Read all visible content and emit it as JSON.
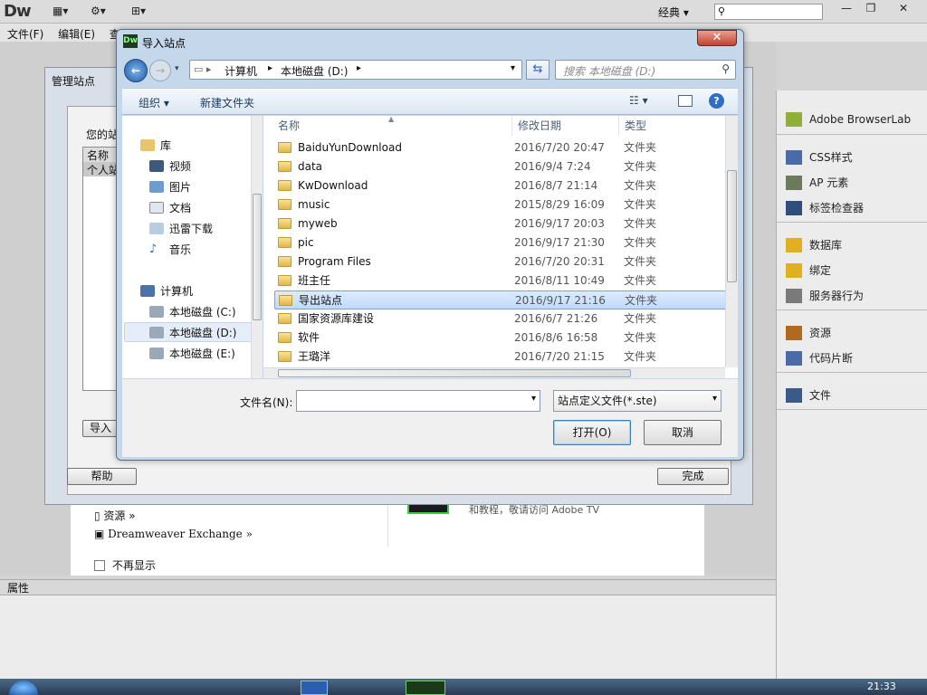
{
  "app": {
    "logo": "Dw",
    "workspace": "经典 ▾",
    "toolbar_icons": [
      "layout-icon",
      "gear-icon",
      "site-icon"
    ],
    "window_buttons": [
      "—",
      "❐",
      "✕"
    ]
  },
  "menu": [
    "文件(F)",
    "编辑(E)",
    "查"
  ],
  "right_panel": {
    "groups": [
      {
        "items": [
          {
            "icon": "browserlab-icon",
            "label": "Adobe BrowserLab"
          }
        ]
      },
      {
        "items": [
          {
            "icon": "css-icon",
            "label": "CSS样式"
          },
          {
            "icon": "ap-icon",
            "label": "AP 元素"
          },
          {
            "icon": "tag-inspector-icon",
            "label": "标签检查器"
          }
        ]
      },
      {
        "items": [
          {
            "icon": "database-icon",
            "label": "数据库"
          },
          {
            "icon": "binding-icon",
            "label": "绑定"
          },
          {
            "icon": "server-behavior-icon",
            "label": "服务器行为"
          }
        ]
      },
      {
        "items": [
          {
            "icon": "assets-icon",
            "label": "资源"
          },
          {
            "icon": "snippets-icon",
            "label": "代码片断"
          }
        ]
      },
      {
        "items": [
          {
            "icon": "files-icon",
            "label": "文件"
          }
        ]
      }
    ]
  },
  "properties": {
    "title": "属性"
  },
  "welcome": {
    "assets_link": "资源 »",
    "exchange_link": "Dreamweaver Exchange »",
    "dont_show": "不再显示",
    "tv_text": "和教程，敬请访问 Adobe TV"
  },
  "manage_sites": {
    "title": "管理站点",
    "your_sites": "您的站",
    "col_name": "名称",
    "site_row": "个人站",
    "import_btn": "导入",
    "help_btn": "帮助",
    "done_btn": "完成"
  },
  "open_dialog": {
    "title": "导入站点",
    "logo": "Dw",
    "breadcrumb": [
      "计算机",
      "本地磁盘 (D:)"
    ],
    "search_placeholder": "搜索 本地磁盘 (D:)",
    "organize": "组织 ▾",
    "new_folder": "新建文件夹",
    "columns": {
      "name": "名称",
      "date": "修改日期",
      "type": "类型"
    },
    "nav": [
      {
        "label": "库",
        "icon": "library-icon",
        "indent": 0
      },
      {
        "label": "视频",
        "icon": "video-icon",
        "indent": 1
      },
      {
        "label": "图片",
        "icon": "pictures-icon",
        "indent": 1
      },
      {
        "label": "文档",
        "icon": "documents-icon",
        "indent": 1
      },
      {
        "label": "迅雷下载",
        "icon": "download-icon",
        "indent": 1
      },
      {
        "label": "音乐",
        "icon": "music-icon",
        "indent": 1
      },
      {
        "label": "计算机",
        "icon": "computer-icon",
        "indent": 0
      },
      {
        "label": "本地磁盘 (C:)",
        "icon": "drive-c-icon",
        "indent": 1
      },
      {
        "label": "本地磁盘 (D:)",
        "icon": "drive-d-icon",
        "indent": 1
      },
      {
        "label": "本地磁盘 (E:)",
        "icon": "drive-e-icon",
        "indent": 1
      }
    ],
    "files": [
      {
        "name": "BaiduYunDownload",
        "date": "2016/7/20 20:47",
        "type": "文件夹"
      },
      {
        "name": "data",
        "date": "2016/9/4 7:24",
        "type": "文件夹"
      },
      {
        "name": "KwDownload",
        "date": "2016/8/7 21:14",
        "type": "文件夹"
      },
      {
        "name": "music",
        "date": "2015/8/29 16:09",
        "type": "文件夹"
      },
      {
        "name": "myweb",
        "date": "2016/9/17 20:03",
        "type": "文件夹"
      },
      {
        "name": "pic",
        "date": "2016/9/17 21:30",
        "type": "文件夹"
      },
      {
        "name": "Program Files",
        "date": "2016/7/20 20:31",
        "type": "文件夹"
      },
      {
        "name": "班主任",
        "date": "2016/8/11 10:49",
        "type": "文件夹"
      },
      {
        "name": "导出站点",
        "date": "2016/9/17 21:16",
        "type": "文件夹",
        "selected": true
      },
      {
        "name": "国家资源库建设",
        "date": "2016/6/7 21:26",
        "type": "文件夹"
      },
      {
        "name": "软件",
        "date": "2016/8/6 16:58",
        "type": "文件夹"
      },
      {
        "name": "王璐洋",
        "date": "2016/7/20 21:15",
        "type": "文件夹"
      }
    ],
    "filename_label": "文件名(N):",
    "filename_value": "",
    "filter": "站点定义文件(*.ste)",
    "open_btn": "打开(O)",
    "cancel_btn": "取消"
  },
  "taskbar": {
    "clock": "21:33"
  },
  "colors": {
    "selection": "#c1dbfa",
    "dialog_frame": "#c5d7ea",
    "accent": "#4c607a"
  }
}
